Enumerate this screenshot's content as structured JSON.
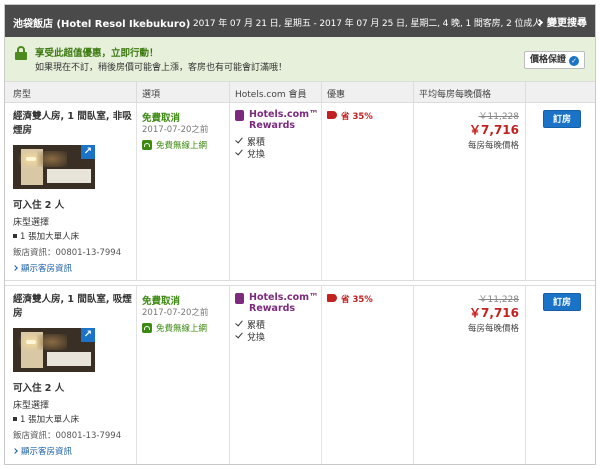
{
  "header": {
    "hotel_name": "池袋飯店 (Hotel Resol Ikebukuro)",
    "booking_summary": "2017 年 07 月 21 日, 星期五 - 2017 年 07 月 25 日, 星期二, 4 晚, 1 間客房, 2 位成人",
    "change_search_label": "變更搜尋"
  },
  "promo": {
    "title": "享受此超值優惠，立即行動！",
    "text": "如果現在不訂，稍後房價可能會上漲，客房也有可能會訂滿哦！",
    "price_guarantee_label": "價格保證"
  },
  "table": {
    "columns": [
      "房型",
      "選項",
      "Hotels.com 會員",
      "優惠",
      "平均每房每晚價格"
    ]
  },
  "rooms": [
    {
      "name": "經濟雙人房, 1 間臥室, 非吸煙房",
      "occupancy": "可入住 2 人",
      "bed_label": "床型選擇",
      "bed_option": "1 張加大單人床",
      "hotel_info": "飯店資訊：00801-13-7994",
      "details_link": "顯示客房資訊",
      "free_cancel": "免費取消",
      "cancel_date": "2017-07-20之前",
      "wifi": "免費無線上網",
      "rewards_line1": "Hotels.com™",
      "rewards_line2": "Rewards",
      "reward_collect": "累積",
      "reward_redeem": "兌換",
      "deal": "省 35%",
      "old_price": "￥11,228",
      "new_price": "￥7,716",
      "price_note": "每房每晚價格",
      "book_label": "訂房"
    },
    {
      "name": "經濟雙人房, 1 間臥室, 吸煙房",
      "occupancy": "可入住 2 人",
      "bed_label": "床型選擇",
      "bed_option": "1 張加大單人床",
      "hotel_info": "飯店資訊：00801-13-7994",
      "details_link": "顯示客房資訊",
      "free_cancel": "免費取消",
      "cancel_date": "2017-07-20之前",
      "wifi": "免費無線上網",
      "rewards_line1": "Hotels.com™",
      "rewards_line2": "Rewards",
      "reward_collect": "累積",
      "reward_redeem": "兌換",
      "deal": "省 35%",
      "old_price": "￥11,228",
      "new_price": "￥7,716",
      "price_note": "每房每晚價格",
      "book_label": "訂房"
    }
  ],
  "colors": {
    "header_bg": "#4a4a4a",
    "promo_bg": "#e7f0da",
    "accent_blue": "#1a73c7",
    "price_red": "#c32020",
    "rewards_purple": "#7c2a7e",
    "success_green": "#3d8a12"
  }
}
